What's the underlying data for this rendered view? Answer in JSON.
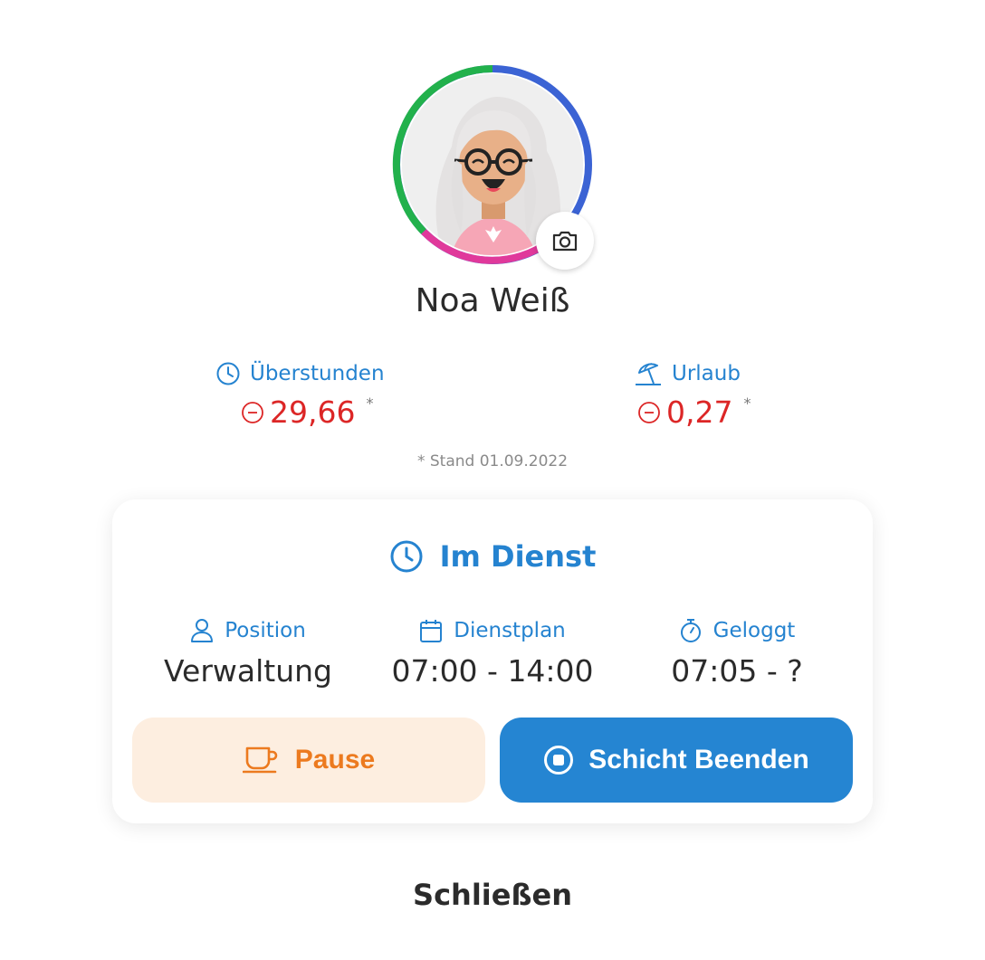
{
  "profile": {
    "name": "Noa Weiß",
    "camera_icon": "camera-icon",
    "ring_colors": {
      "blue": "#3b63d4",
      "green": "#22b14c",
      "pink": "#e0399b"
    }
  },
  "stats": {
    "overtime": {
      "label": "Überstunden",
      "icon": "clock-icon",
      "value": "29,66",
      "sign_icon": "minus-circle-icon",
      "asterisk": "*"
    },
    "vacation": {
      "label": "Urlaub",
      "icon": "beach-umbrella-icon",
      "value": "0,27",
      "sign_icon": "minus-circle-icon",
      "asterisk": "*"
    },
    "note": "* Stand 01.09.2022",
    "negative_color": "#dc2626"
  },
  "duty_card": {
    "title": "Im Dienst",
    "title_icon": "clock-icon",
    "position": {
      "label": "Position",
      "icon": "user-icon",
      "value": "Verwaltung"
    },
    "schedule": {
      "label": "Dienstplan",
      "icon": "calendar-icon",
      "value": "07:00 - 14:00"
    },
    "logged": {
      "label": "Geloggt",
      "icon": "stopwatch-icon",
      "value": "07:05 - ?"
    },
    "pause_button": {
      "label": "Pause",
      "icon": "coffee-cup-icon"
    },
    "end_button": {
      "label": "Schicht Beenden",
      "icon": "stop-circle-icon"
    },
    "accent_color": "#2583d0"
  },
  "close_label": "Schließen"
}
